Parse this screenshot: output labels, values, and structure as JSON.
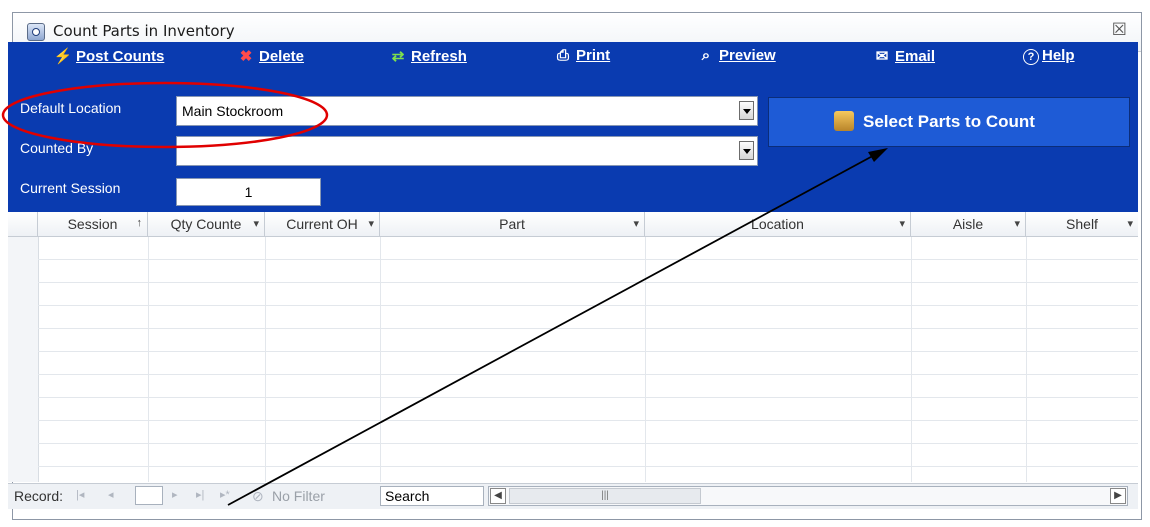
{
  "window": {
    "title": "Count Parts in Inventory",
    "close_glyph": "☒"
  },
  "toolbar": [
    {
      "label": "Post Counts",
      "icon": "lightning-icon",
      "glyph": "⚡"
    },
    {
      "label": "Delete",
      "icon": "delete-icon",
      "glyph": "✖"
    },
    {
      "label": "Refresh",
      "icon": "refresh-icon",
      "glyph": "⇄"
    },
    {
      "label": "Print",
      "icon": "print-icon",
      "glyph": "⎙"
    },
    {
      "label": "Preview",
      "icon": "preview-icon",
      "glyph": "⌕"
    },
    {
      "label": "Email",
      "icon": "email-icon",
      "glyph": "✉"
    },
    {
      "label": "Help",
      "icon": "help-icon",
      "glyph": "?"
    }
  ],
  "form": {
    "default_location_label": "Default Location",
    "default_location_value": "Main Stockroom",
    "counted_by_label": "Counted By",
    "counted_by_value": "",
    "current_session_label": "Current Session",
    "current_session_value": "1",
    "select_button_label": "Select Parts to Count"
  },
  "grid": {
    "columns": [
      {
        "label": "Session",
        "sort": "↑"
      },
      {
        "label": "Qty Counte",
        "sort": "▾"
      },
      {
        "label": "Current OH",
        "sort": "▾"
      },
      {
        "label": "Part",
        "sort": "▾"
      },
      {
        "label": "Location",
        "sort": "▾"
      },
      {
        "label": "Aisle",
        "sort": "▾"
      },
      {
        "label": "Shelf",
        "sort": "▾"
      }
    ]
  },
  "navbar": {
    "record_label": "Record:",
    "first": "|◂",
    "prev": "◂",
    "next": "▸",
    "last": "▸|",
    "new": "▸*",
    "filter_label": "No Filter",
    "search_value": "Search"
  },
  "colors": {
    "ribbon": "#0a3bb0",
    "button": "#1e5bd6",
    "annotation_red": "#e00000"
  }
}
